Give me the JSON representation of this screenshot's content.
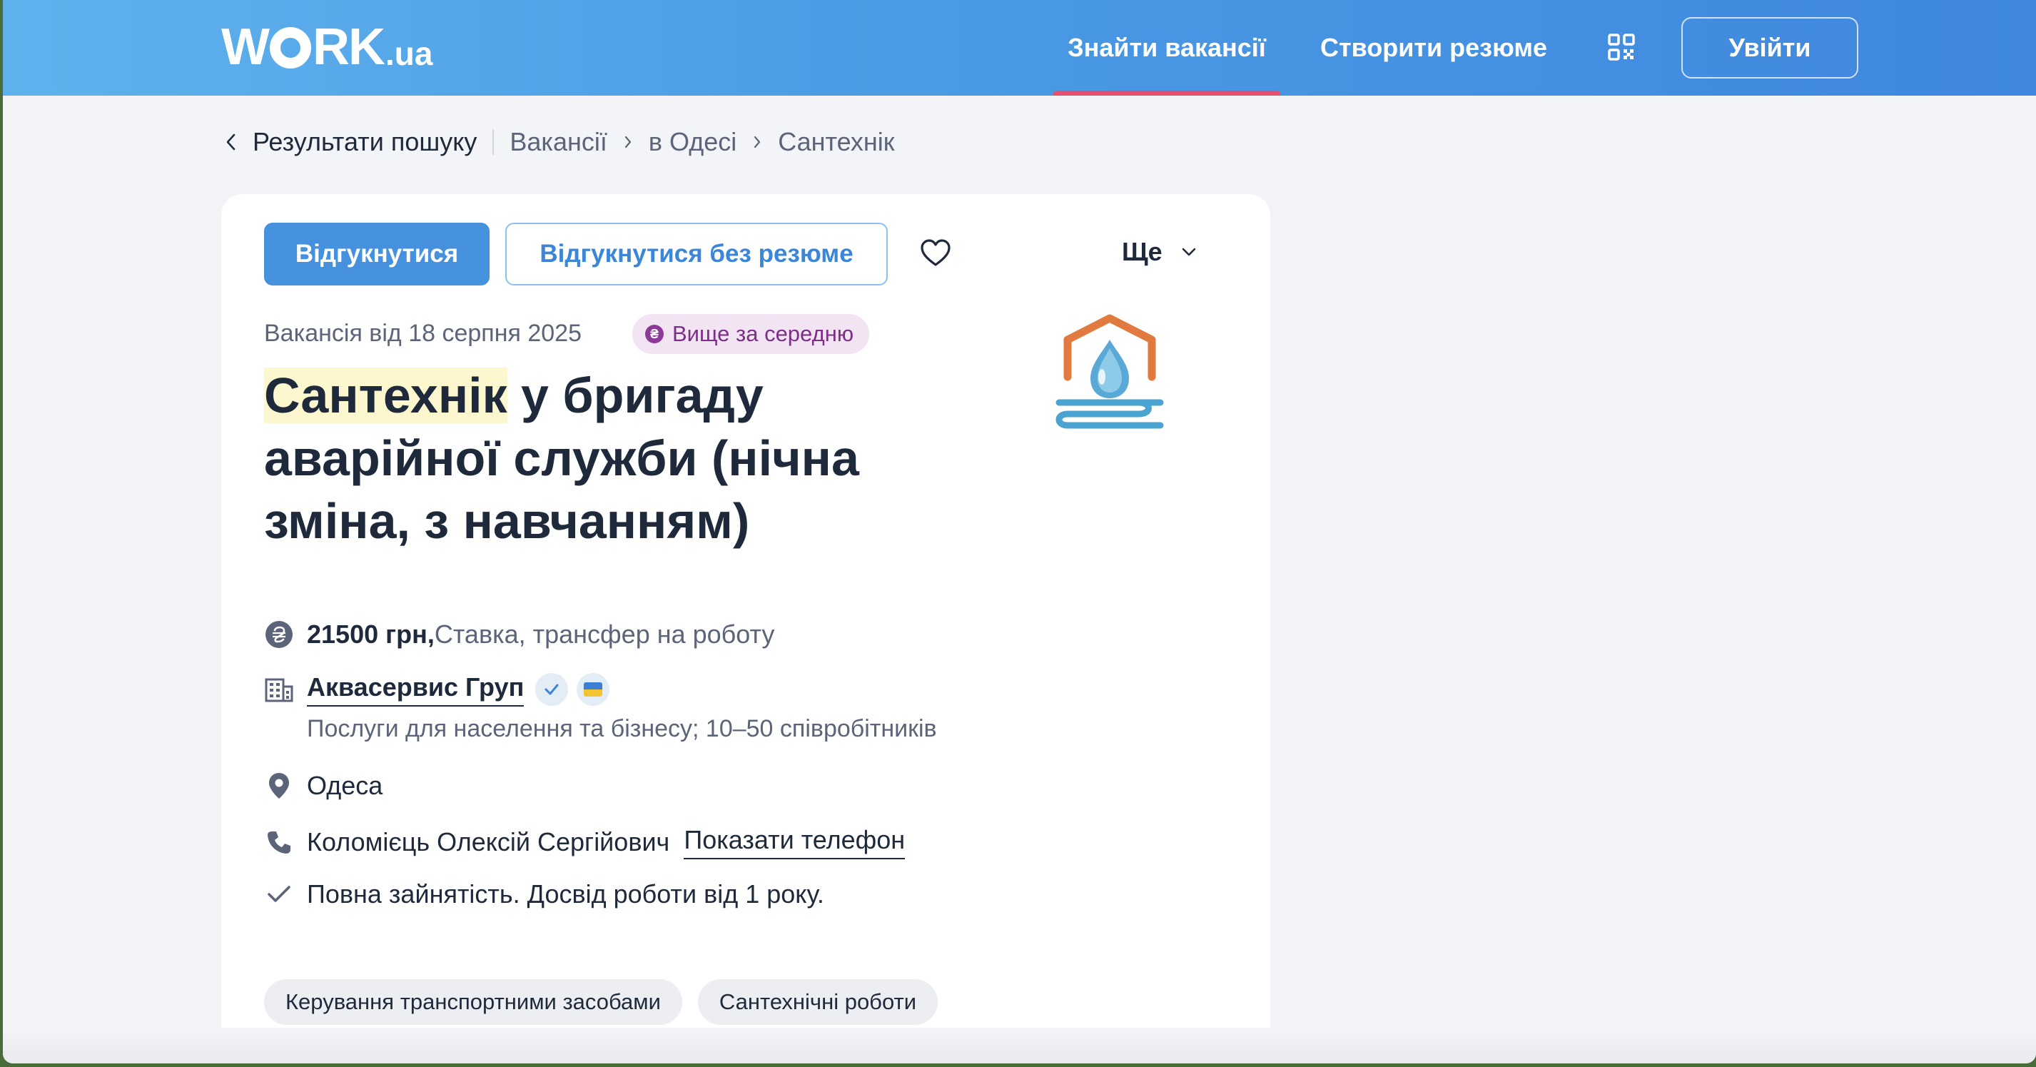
{
  "header": {
    "logo_main": "WORK",
    "logo_suffix": ".ua",
    "nav_find": "Знайти вакансії",
    "nav_create": "Створити резюме",
    "qr_icon": "qr-code-icon",
    "login": "Увійти",
    "accent_color": "#e5506f"
  },
  "breadcrumbs": {
    "back": "Результати пошуку",
    "items": [
      "Вакансії",
      "в Одесі",
      "Сантехнік"
    ]
  },
  "actions": {
    "apply": "Відгукнутися",
    "apply_no_resume": "Відгукнутися без резюме",
    "favorite_icon": "heart-icon",
    "more": "Ще"
  },
  "vacancy": {
    "date": "Вакансія від 18 серпня 2025",
    "badge": "Вище за середню",
    "badge_icon": "₴",
    "title_highlight": "Сантехнік",
    "title_rest": " у бригаду аварійної служби (нічна зміна, з навчанням)",
    "salary_amount": "21500 грн,",
    "salary_details": " Ставка, трансфер на роботу",
    "company_name": "Аквасервис Груп",
    "company_description": "Послуги для населення та бізнесу; 10–50 співробітників",
    "city": "Одеса",
    "contact_name": "Коломієць Олексій Сергійович",
    "show_phone": "Показати телефон",
    "conditions": "Повна зайнятість. Досвід роботи від 1 року.",
    "tags": [
      "Керування транспортними засобами",
      "Сантехнічні роботи"
    ]
  },
  "colors": {
    "primary": "#4591de",
    "text": "#1e2a3b",
    "muted": "#5b6478",
    "highlight": "#fdf7cf",
    "badge_bg": "#f3e4f4"
  }
}
